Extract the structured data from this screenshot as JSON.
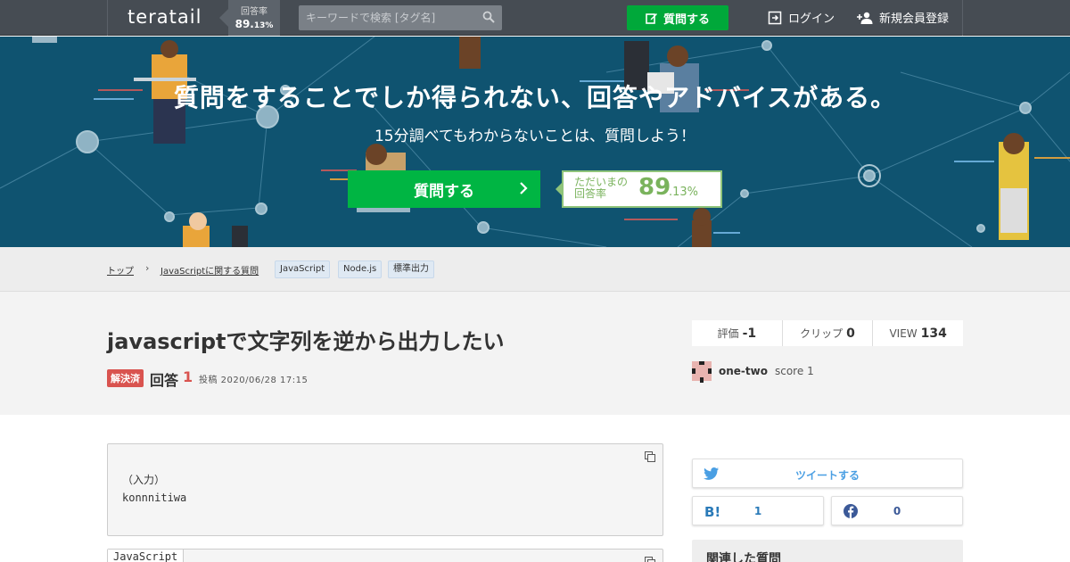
{
  "header": {
    "logo": "teratail",
    "rate_label": "回答率",
    "rate_main": "89.",
    "rate_decimal": "13%",
    "search_placeholder": "キーワードで検索 [タグ名]",
    "ask_label": "質問する",
    "login_label": "ログイン",
    "signup_label": "新規会員登録"
  },
  "hero": {
    "title": "質問をすることでしか得られない、回答やアドバイスがある。",
    "subtitle": "15分調べてもわからないことは、質問しよう！",
    "ask_label": "質問する",
    "rate_label": "ただいまの回答率",
    "rate_main": "89",
    "rate_decimal": ".13%"
  },
  "breadcrumb": {
    "items": [
      "トップ",
      "JavaScriptに関する質問"
    ],
    "separator": "›",
    "tags": [
      "JavaScript",
      "Node.js",
      "標準出力"
    ]
  },
  "question": {
    "title": "javascriptで文字列を逆から出力したい",
    "status": "解決済",
    "answers_label": "回答",
    "answers_count": "1",
    "posted": "投稿 2020/06/28 17:15",
    "stats": [
      {
        "label": "評価",
        "value": "-1"
      },
      {
        "label": "クリップ",
        "value": "0"
      },
      {
        "label": "VIEW",
        "value": "134"
      }
    ],
    "author": {
      "name": "one-two",
      "score_label": "score",
      "score": "1"
    }
  },
  "content": {
    "code1": "（入力）\nkonnnitiwa",
    "code2_lang": "JavaScript"
  },
  "sidebar": {
    "tweet_label": "ツイートする",
    "hatena_count": "1",
    "facebook_count": "0",
    "related_title": "関連した質問"
  },
  "colors": {
    "header_bg": "#464c53",
    "hero_bg": "#0f5370",
    "accent_green": "#00a83a",
    "rate_green": "#7ab35d",
    "solved_red": "#d9534f",
    "twitter": "#4a9fe3",
    "facebook": "#3b5998"
  }
}
